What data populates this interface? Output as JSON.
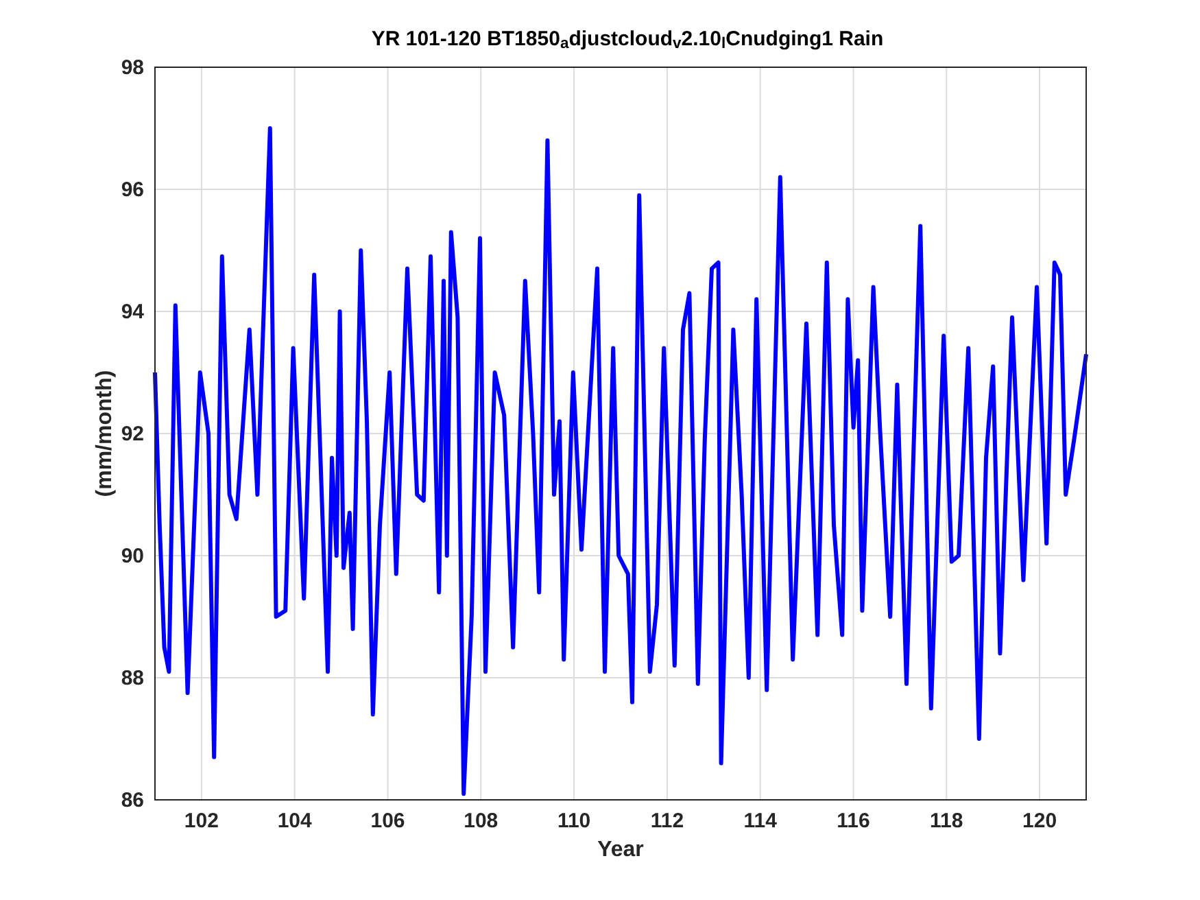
{
  "figure": {
    "chart_data": {
      "type": "line",
      "title": "YR 101-120 BT1850$_{a}$djustcloud$_{v}$2.10$_{l}$Cnudging1 Rain",
      "xlabel": "Year",
      "ylabel": "(mm/month)",
      "grid": true,
      "xlim": [
        101,
        121
      ],
      "ylim": [
        86,
        98
      ],
      "xticks": [
        102,
        104,
        106,
        108,
        110,
        112,
        114,
        116,
        118,
        120
      ],
      "yticks": [
        86,
        88,
        90,
        92,
        94,
        96,
        98
      ],
      "x": [
        101.0,
        101.1,
        101.2,
        101.3,
        101.44,
        101.7,
        101.97,
        102.15,
        102.27,
        102.44,
        102.6,
        102.75,
        103.03,
        103.2,
        103.47,
        103.6,
        103.8,
        103.97,
        104.2,
        104.42,
        104.71,
        104.8,
        104.9,
        104.97,
        105.05,
        105.18,
        105.25,
        105.42,
        105.55,
        105.68,
        105.83,
        106.04,
        106.18,
        106.42,
        106.63,
        106.77,
        106.92,
        107.1,
        107.2,
        107.27,
        107.36,
        107.5,
        107.63,
        107.8,
        107.98,
        108.1,
        108.3,
        108.5,
        108.69,
        108.95,
        109.12,
        109.25,
        109.43,
        109.57,
        109.69,
        109.78,
        109.98,
        110.16,
        110.5,
        110.66,
        110.84,
        110.96,
        111.16,
        111.25,
        111.4,
        111.63,
        111.78,
        111.93,
        112.16,
        112.34,
        112.48,
        112.66,
        112.81,
        112.96,
        113.1,
        113.16,
        113.42,
        113.6,
        113.75,
        113.92,
        114.14,
        114.43,
        114.7,
        114.99,
        115.23,
        115.43,
        115.58,
        115.76,
        115.88,
        116.0,
        116.1,
        116.19,
        116.43,
        116.57,
        116.79,
        116.94,
        117.14,
        117.44,
        117.67,
        117.94,
        118.11,
        118.26,
        118.47,
        118.7,
        118.85,
        119.0,
        119.15,
        119.41,
        119.65,
        119.94,
        120.15,
        120.32,
        120.44,
        120.56,
        120.74,
        121.0
      ],
      "series": [
        {
          "color": "#0000ff",
          "values": [
            93.0,
            90.5,
            88.5,
            88.1,
            94.1,
            87.75,
            93.0,
            92.0,
            86.7,
            94.9,
            91.0,
            90.6,
            93.7,
            91.0,
            97.0,
            89.0,
            89.1,
            93.4,
            89.3,
            94.6,
            88.1,
            91.6,
            90.0,
            94.0,
            89.8,
            90.7,
            88.8,
            95.0,
            92.2,
            87.4,
            90.5,
            93.0,
            89.7,
            94.7,
            91.0,
            90.9,
            94.9,
            89.4,
            94.5,
            90.0,
            95.3,
            93.9,
            86.1,
            89.0,
            95.2,
            88.1,
            93.0,
            92.3,
            88.5,
            94.5,
            92.0,
            89.4,
            96.8,
            91.0,
            92.2,
            88.3,
            93.0,
            90.1,
            94.7,
            88.1,
            93.4,
            90.0,
            89.7,
            87.6,
            95.9,
            88.1,
            89.2,
            93.4,
            88.2,
            93.7,
            94.3,
            87.9,
            91.9,
            94.7,
            94.8,
            86.6,
            93.7,
            91.0,
            88.0,
            94.2,
            87.8,
            96.2,
            88.3,
            93.8,
            88.7,
            94.8,
            90.5,
            88.7,
            94.2,
            92.1,
            93.2,
            89.1,
            94.4,
            92.1,
            89.0,
            92.8,
            87.9,
            95.4,
            87.5,
            93.6,
            89.9,
            90.0,
            93.4,
            87.0,
            91.6,
            93.1,
            88.4,
            93.9,
            89.6,
            94.4,
            90.2,
            94.8,
            94.6,
            91.0,
            91.9,
            93.3
          ]
        }
      ]
    }
  }
}
